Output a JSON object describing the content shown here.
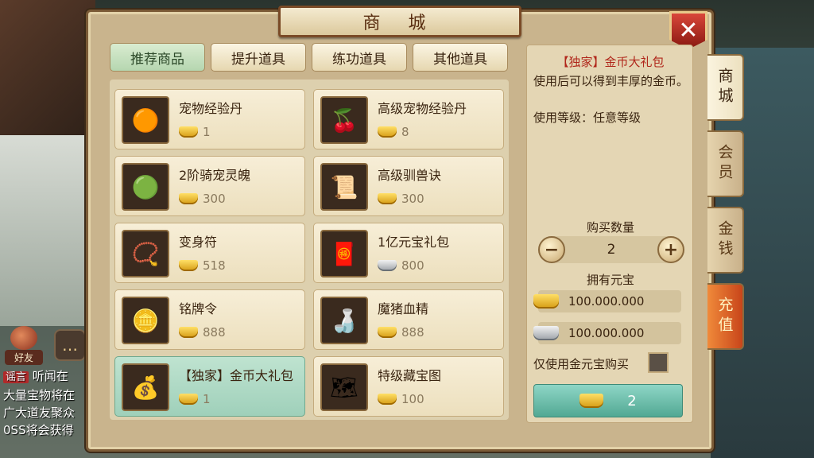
{
  "window": {
    "title": "商 城"
  },
  "chat": {
    "friend_label": "好友",
    "lines": [
      "听闻在",
      "大量宝物将在",
      "广大道友聚众",
      "0SS将会获得"
    ],
    "rumor_tag": "谣言"
  },
  "tabs": [
    "推荐商品",
    "提升道具",
    "练功道具",
    "其他道具"
  ],
  "items": [
    {
      "name": "宠物经验丹",
      "price": "1",
      "currency": "gold",
      "icon": "orbs-icon"
    },
    {
      "name": "高级宠物经验丹",
      "price": "8",
      "currency": "gold",
      "icon": "berries-icon"
    },
    {
      "name": "2阶骑宠灵魄",
      "price": "300",
      "currency": "gold",
      "icon": "green-orb-icon"
    },
    {
      "name": "高级驯兽诀",
      "price": "300",
      "currency": "gold",
      "icon": "scroll-icon"
    },
    {
      "name": "变身符",
      "price": "518",
      "currency": "gold",
      "icon": "talisman-icon"
    },
    {
      "name": "1亿元宝礼包",
      "price": "800",
      "currency": "silver",
      "icon": "red-envelope-icon"
    },
    {
      "name": "铭牌令",
      "price": "888",
      "currency": "gold",
      "icon": "token-icon"
    },
    {
      "name": "魔猪血精",
      "price": "888",
      "currency": "gold",
      "icon": "bottle-icon"
    },
    {
      "name": "【独家】金币大礼包",
      "price": "1",
      "currency": "gold",
      "icon": "coins-icon"
    },
    {
      "name": "特级藏宝图",
      "price": "100",
      "currency": "gold",
      "icon": "map-icon"
    }
  ],
  "detail": {
    "title": "【独家】金币大礼包",
    "desc": "使用后可以得到丰厚的金币。",
    "level": "使用等级：任意等级",
    "qty_label": "购买数量",
    "qty": "2",
    "own_label": "拥有元宝",
    "gold_amount": "100.000.000",
    "silver_amount": "100.000.000",
    "gold_only_label": "仅使用金元宝购买",
    "buy_total": "2"
  },
  "side_tabs": [
    "商城",
    "会员",
    "金钱",
    "充值"
  ]
}
